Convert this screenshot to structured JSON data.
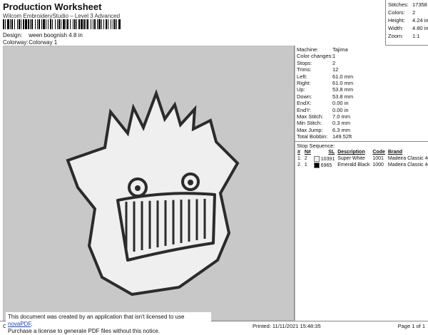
{
  "header": {
    "title": "Production Worksheet",
    "subtitle": "Wilcom EmbroideryStudio – Level 3 Advanced",
    "design_label": "Design:",
    "design_value": "ween boognish 4.8 in",
    "colorway_label": "Colorway:",
    "colorway_value": "Colorway 1"
  },
  "summary": [
    {
      "label": "Stitches:",
      "value": "17358"
    },
    {
      "label": "Colors:",
      "value": "2"
    },
    {
      "label": "Height:",
      "value": "4.24 in"
    },
    {
      "label": "Width:",
      "value": "4.80 in"
    },
    {
      "label": "Zoom:",
      "value": "1:1"
    }
  ],
  "specs": [
    {
      "label": "Machine:",
      "value": "Tajima"
    },
    {
      "label": "Color changes:",
      "value": "1"
    },
    {
      "label": "Stops:",
      "value": "2"
    },
    {
      "label": "Trims:",
      "value": "12"
    },
    {
      "label": "Left:",
      "value": "61.0 mm"
    },
    {
      "label": "Right:",
      "value": "61.0 mm"
    },
    {
      "label": "Up:",
      "value": "53.8 mm"
    },
    {
      "label": "Down:",
      "value": "53.8 mm"
    },
    {
      "label": "EndX:",
      "value": "0.00 in"
    },
    {
      "label": "EndY:",
      "value": "0.00 in"
    },
    {
      "label": "Max Stitch:",
      "value": "7.0 mm"
    },
    {
      "label": "Min Stitch:",
      "value": "0.3 mm"
    },
    {
      "label": "Max Jump:",
      "value": "6.3 mm"
    },
    {
      "label": "Total Bobbin:",
      "value": "149.52ft"
    }
  ],
  "stop_sequence": {
    "title": "Stop Sequence:",
    "columns": [
      "#",
      "N#",
      "SL",
      "Description",
      "Code",
      "Brand"
    ],
    "rows": [
      {
        "num": "1.",
        "n": "2",
        "color": "#f2f2f2",
        "sl": "10391",
        "description": "Super White",
        "code": "1001",
        "brand": "Madeira Classic 40"
      },
      {
        "num": "2.",
        "n": "1",
        "color": "#000000",
        "sl": "6965",
        "description": "Emerald Black",
        "code": "1000",
        "brand": "Madeira Classic 40"
      }
    ]
  },
  "notice": {
    "line1_prefix": "This document was created by an application that isn't licensed to use ",
    "link": "novaPDF",
    "line1_suffix": ".",
    "line2": "Purchase a license to generate PDF files without this notice."
  },
  "footer": {
    "left": "Cr",
    "printed": "Printed: 11/11/2021 15:48:35",
    "page": "Page 1 of 1"
  },
  "colors": {
    "panel_bg": "#c8c8c8",
    "fill_white": "#efefef",
    "outline": "#2b2b2b"
  }
}
